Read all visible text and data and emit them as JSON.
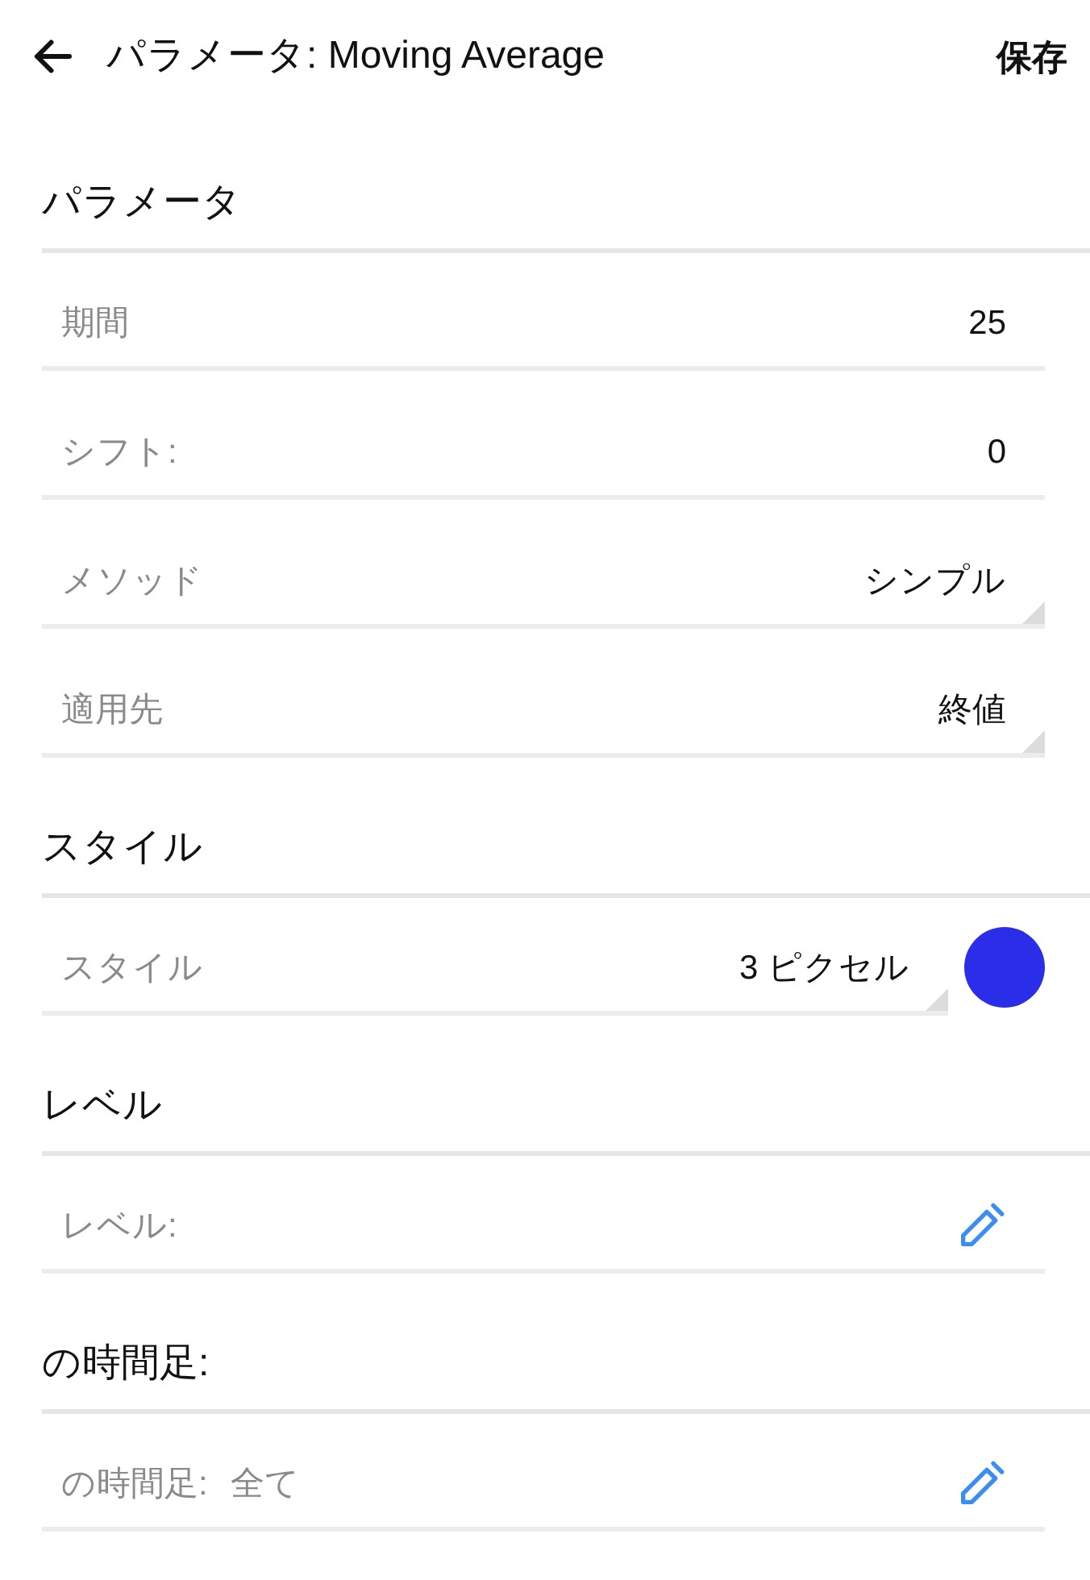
{
  "header": {
    "title": "パラメータ: Moving Average",
    "save": "保存"
  },
  "sections": [
    {
      "title": "パラメータ",
      "rows": [
        {
          "kind": "value",
          "label": "期間",
          "value": "25"
        },
        {
          "kind": "value",
          "label": "シフト:",
          "value": "0"
        },
        {
          "kind": "select",
          "label": "メソッド",
          "value": "シンプル"
        },
        {
          "kind": "select",
          "label": "適用先",
          "value": "終値"
        }
      ]
    },
    {
      "title": "スタイル",
      "rows": [
        {
          "kind": "select_color",
          "label": "スタイル",
          "value": "3 ピクセル",
          "color": "#2a2ee8"
        }
      ]
    },
    {
      "title": "レベル",
      "rows": [
        {
          "kind": "edit",
          "label": "レベル:"
        }
      ]
    },
    {
      "title": "の時間足:",
      "rows": [
        {
          "kind": "edit",
          "label": "の時間足:",
          "value": "全て"
        }
      ]
    }
  ]
}
